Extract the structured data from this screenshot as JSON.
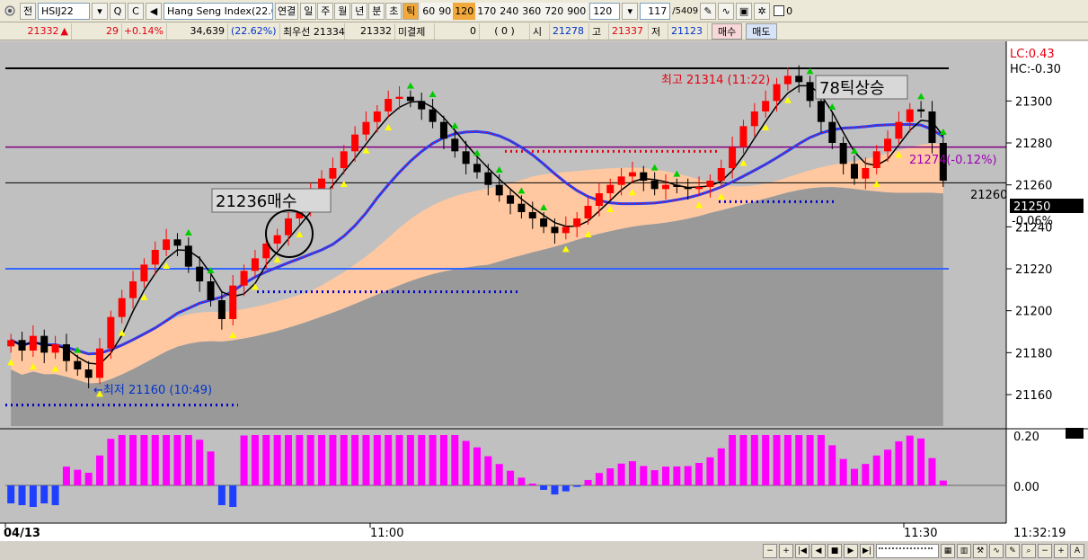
{
  "toolbar": {
    "jeon": "전",
    "symbol": "HSIJ22",
    "product": "Hang Seng Index(22.0",
    "link_label": "연결",
    "periods": [
      "일",
      "주",
      "월",
      "년",
      "분",
      "초",
      "틱"
    ],
    "active_period": "틱",
    "tick_values": [
      "60",
      "90",
      "120",
      "170",
      "240",
      "360",
      "720",
      "900"
    ],
    "active_tick": "120",
    "tick_select": "120",
    "count_value": "117",
    "count_total": "/5409",
    "checkbox_label": "0"
  },
  "quote": {
    "price": "21332",
    "arrow": "▲",
    "change": "29",
    "change_pct": "+0.14%",
    "volume": "34,639",
    "volume_pct": "22.62%",
    "best_label": "최우선 21334",
    "best_bid": "21332",
    "unfilled_label": "미결제",
    "unfilled_value": "0",
    "unfilled_change": "0",
    "open_label": "시",
    "open_value": "21278",
    "high_label": "고",
    "high_value": "21337",
    "low_label": "저",
    "low_value": "21123",
    "buy_label": "매수",
    "sell_label": "매도"
  },
  "chart": {
    "lc_label": "LC:0.43",
    "hc_label": "HC:-0.30",
    "y_ticks": [
      "21300",
      "21280",
      "21260",
      "21240",
      "21220",
      "21200",
      "21180",
      "21160"
    ],
    "current_price_label": "21250",
    "ref_price_label": "21260",
    "current_pct": "-0.06%",
    "purple_line_label": "21274(-0.12%)",
    "low_annotation": "←최저 21160 (10:49)",
    "high_annotation": "최고 21314 (11:22)",
    "callout_buy": "21236매수",
    "callout_rise": "78틱상승",
    "osc_ticks": [
      "0.20",
      "0.00"
    ],
    "osc_current": "0.20",
    "x_labels": [
      "04/13",
      "11:00",
      "11:30"
    ],
    "time_label": "11:32:19",
    "colors": {
      "up": "#ff0000",
      "down": "#000000",
      "ma_blue": "#1f3fff",
      "cloud": "#ffc8a0",
      "bg": "#c0c0c0",
      "osc": "#ff00ff"
    }
  },
  "chart_data": {
    "type": "line",
    "title": "",
    "ylim": [
      21145,
      21325
    ],
    "series": [
      {
        "values": [
          21186,
          21181,
          21188,
          21180,
          21184,
          21176,
          21172,
          21168,
          21182,
          21197,
          21206,
          21214,
          21222,
          21229,
          21234,
          21231,
          21221,
          21214,
          21205,
          21196,
          21212,
          21219,
          21225,
          21232,
          21236,
          21244,
          21250,
          21258,
          21263,
          21268,
          21276,
          21284,
          21290,
          21295,
          21301,
          21302,
          21300,
          21296,
          21290,
          21282,
          21276,
          21270,
          21266,
          21260,
          21255,
          21251,
          21247,
          21244,
          21240,
          21237,
          21240,
          21244,
          21250,
          21256,
          21260,
          21264,
          21266,
          21262,
          21258,
          21260,
          21259,
          21258,
          21259,
          21262,
          21268,
          21278,
          21288,
          21295,
          21300,
          21308,
          21312,
          21309,
          21300,
          21290,
          21280,
          21270,
          21263,
          21268,
          21276,
          21282,
          21290,
          21296,
          21295,
          21280,
          21262
        ]
      }
    ]
  }
}
